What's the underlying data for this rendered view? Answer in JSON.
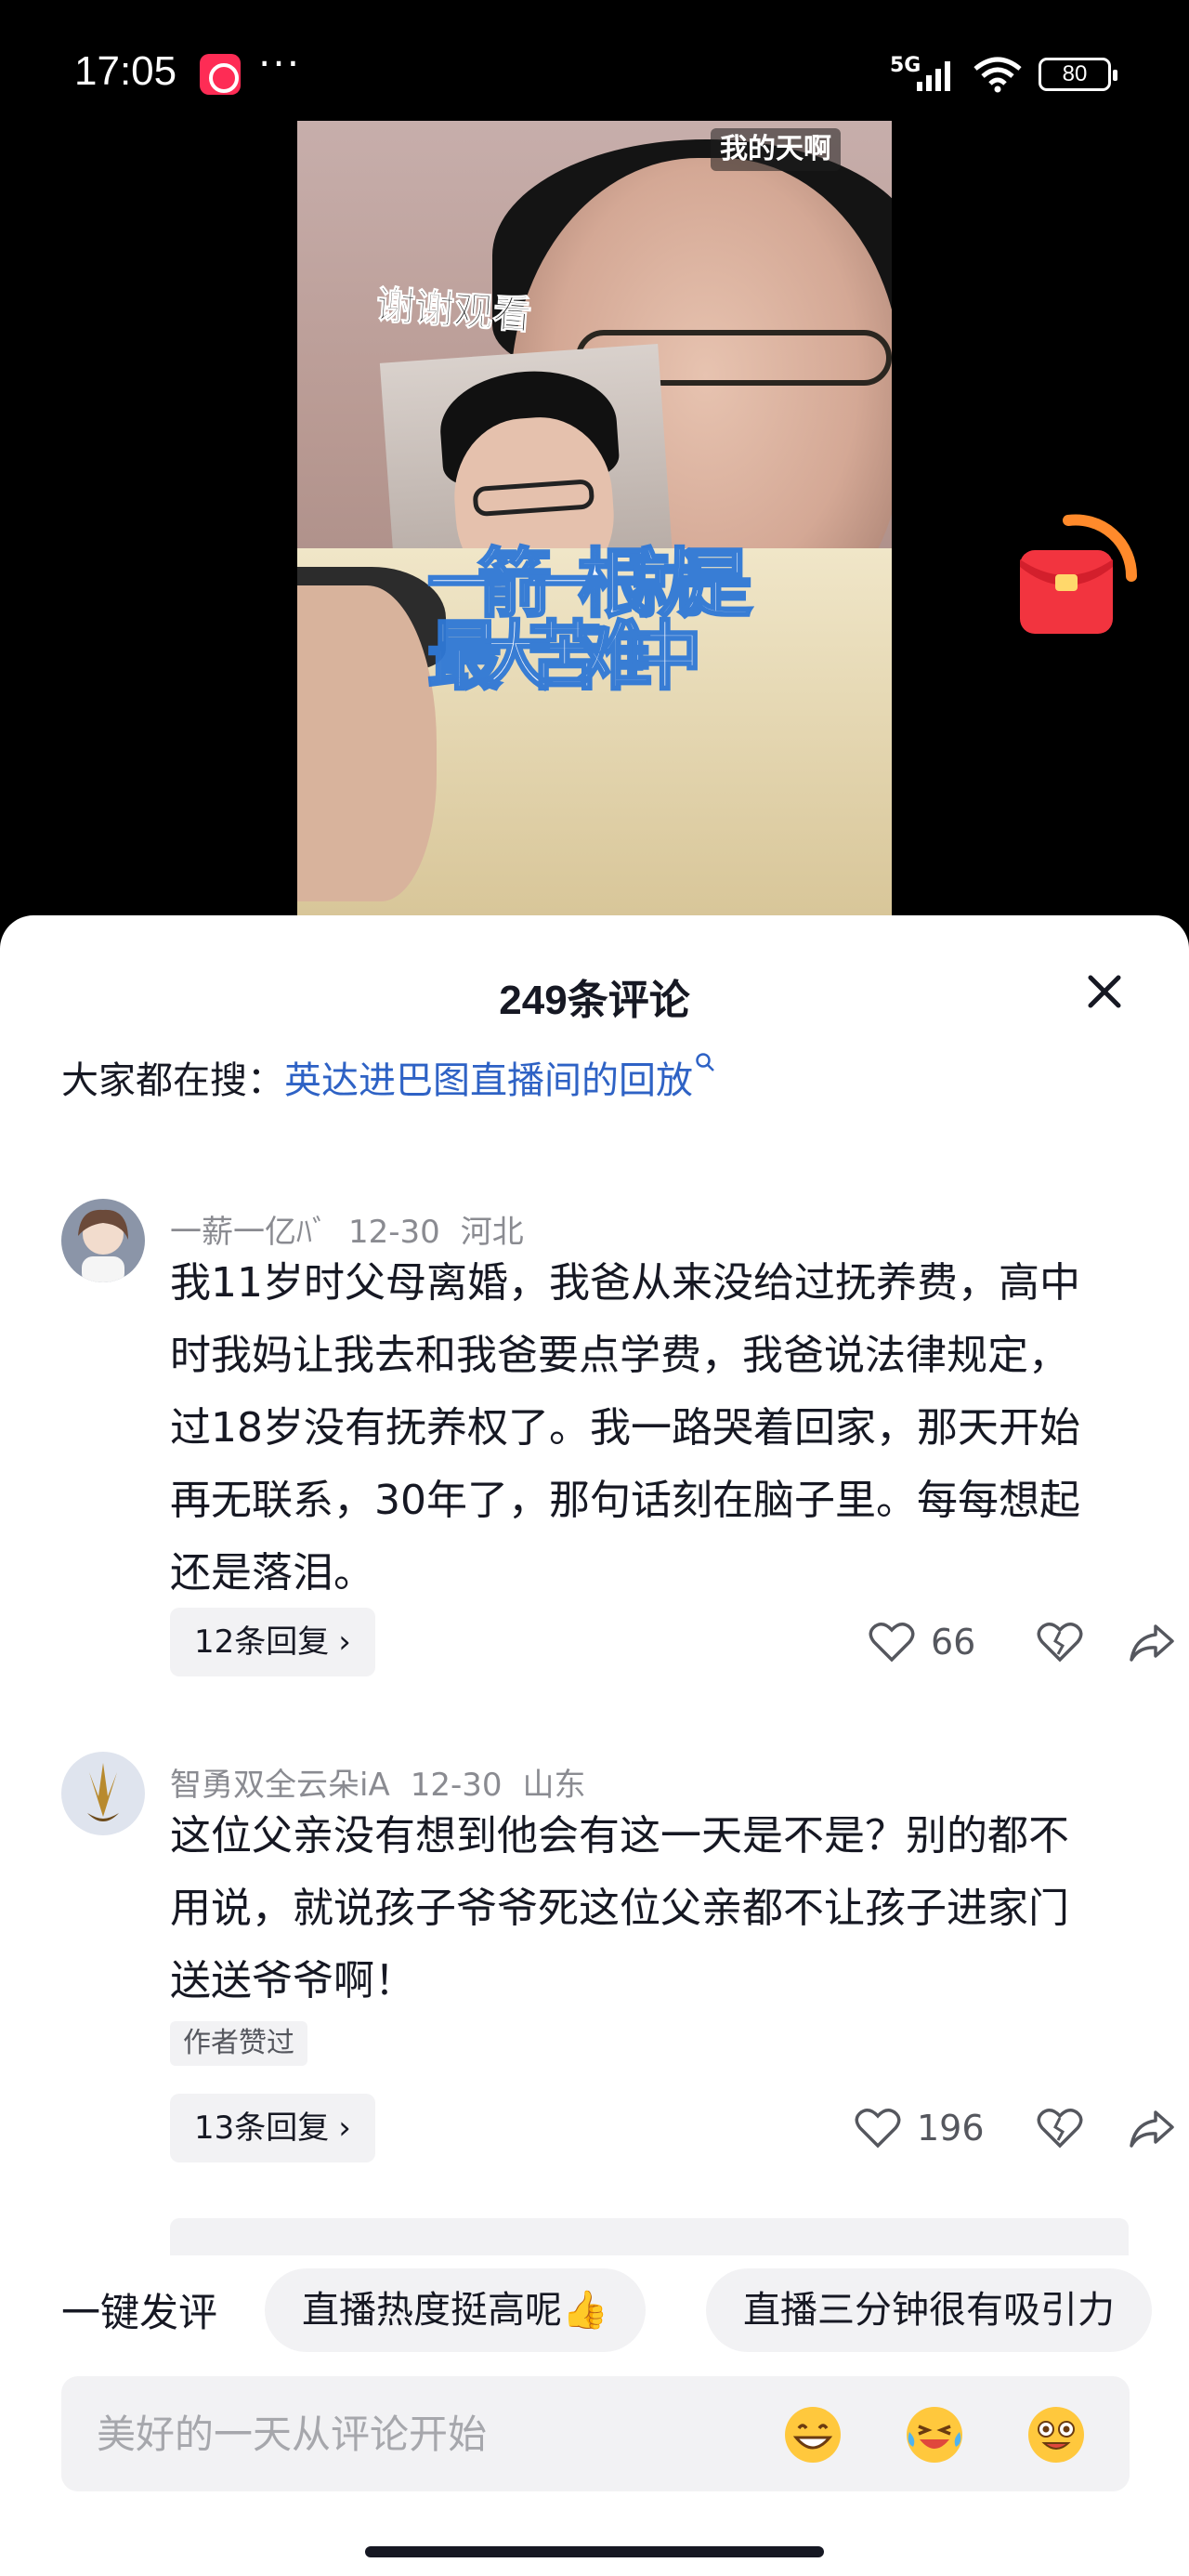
{
  "status_bar": {
    "time": "17:05",
    "network": "5G",
    "battery": "80"
  },
  "video": {
    "watermark": "我的天啊",
    "overlay_text": "谢谢观看",
    "scribble_text": "一箭一根就是最大苦难中"
  },
  "comments_panel": {
    "title": "249条评论",
    "search_label": "大家都在搜：",
    "search_query": "英达进巴图直播间的回放",
    "comments": [
      {
        "username": "一薪一亿ﾊﾞ",
        "date": "12-30",
        "location": "河北",
        "text": "我11岁时父母离婚，我爸从来没给过抚养费，高中时我妈让我去和我爸要点学费，我爸说法律规定，过18岁没有抚养权了。我一路哭着回家，那天开始再无联系，30年了，那句话刻在脑子里。每每想起还是落泪。",
        "replies_label": "12条回复",
        "likes": "66",
        "author_liked": ""
      },
      {
        "username": "智勇双全云朵iA",
        "date": "12-30",
        "location": "山东",
        "text": "这位父亲没有想到他会有这一天是不是？别的都不用说，就说孩子爷爷死这位父亲都不让孩子进家门送送爷爷啊！",
        "replies_label": "13条回复",
        "likes": "196",
        "author_liked": "作者赞过"
      }
    ]
  },
  "composer": {
    "quick_label": "一键发评",
    "quick_chips": [
      "直播热度挺高呢👍",
      "直播三分钟很有吸引力"
    ],
    "placeholder": "美好的一天从评论开始",
    "emojis": [
      "grinning-emoji",
      "laughing-crying-emoji",
      "star-struck-emoji"
    ]
  },
  "colors": {
    "link": "#2e62c5",
    "accent_red": "#fe2c55",
    "text_primary": "#161823",
    "text_secondary": "#8a8b91"
  }
}
